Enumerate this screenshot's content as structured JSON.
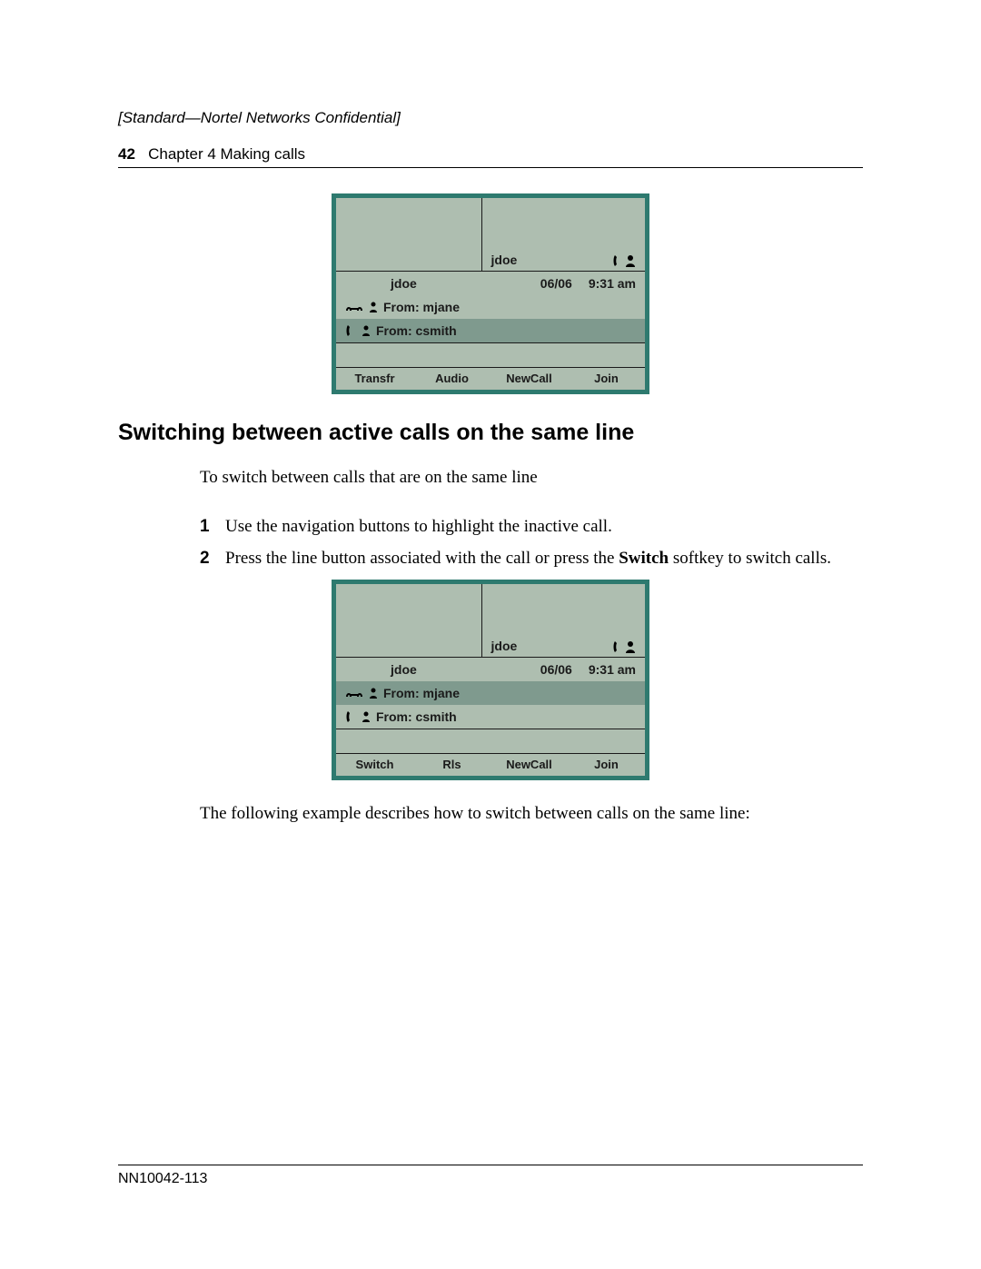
{
  "header": {
    "confidential": "[Standard—Nortel Networks Confidential]",
    "page_number": "42",
    "chapter": "Chapter 4  Making calls"
  },
  "screen1": {
    "top_right_label": "jdoe",
    "row_user": "jdoe",
    "row_date": "06/06",
    "row_time": "9:31 am",
    "call1": "From: mjane",
    "call2": "From: csmith",
    "softkeys": [
      "Transfr",
      "Audio",
      "NewCall",
      "Join"
    ]
  },
  "section_heading": "Switching between active calls on the same line",
  "intro": "To switch between calls that are on the same line",
  "steps": [
    {
      "num": "1",
      "text": "Use the navigation buttons to highlight the inactive call."
    },
    {
      "num": "2",
      "prefix": "Press the line button associated with the call or press the ",
      "bold": "Switch",
      "suffix": " softkey to switch calls."
    }
  ],
  "screen2": {
    "top_right_label": "jdoe",
    "row_user": "jdoe",
    "row_date": "06/06",
    "row_time": "9:31 am",
    "call1": "From: mjane",
    "call2": "From: csmith",
    "softkeys": [
      "Switch",
      "Rls",
      "NewCall",
      "Join"
    ]
  },
  "after_text": "The following example describes how to switch between calls on the same line:",
  "footer": "NN10042-113"
}
